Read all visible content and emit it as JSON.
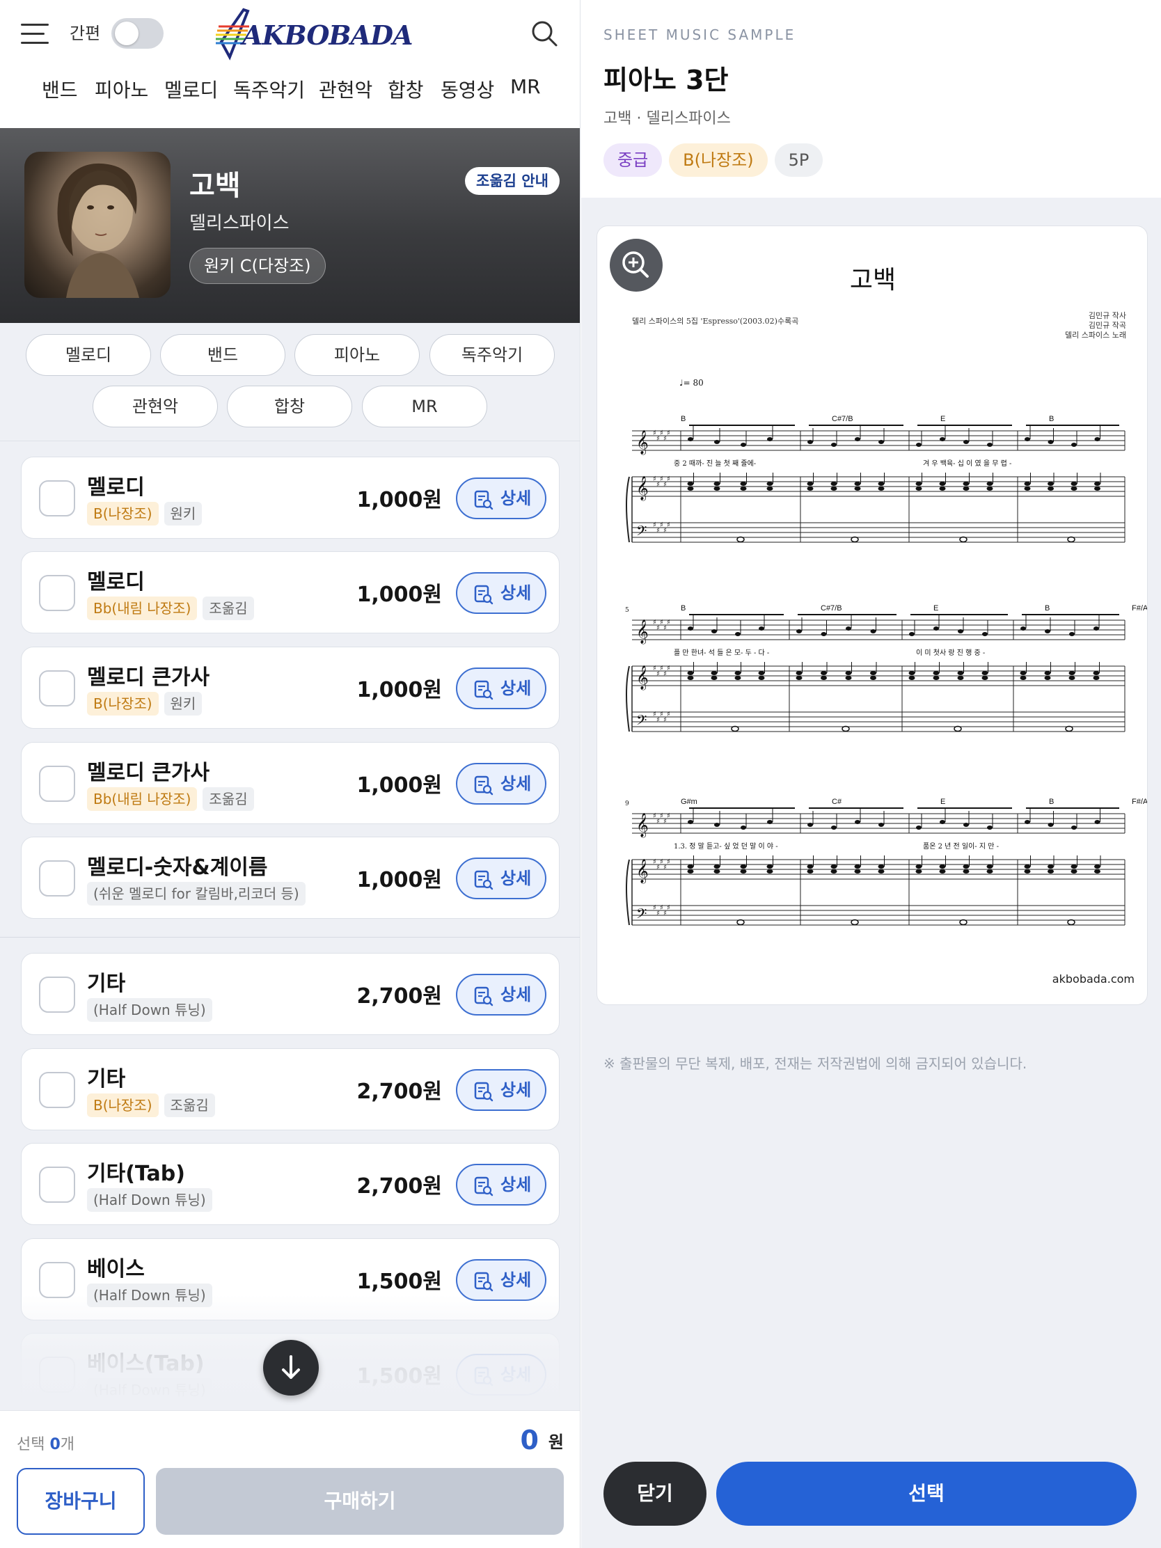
{
  "header": {
    "simple_label": "간편",
    "logo_text": "AKBOBADA",
    "nav": [
      "밴드",
      "피아노",
      "멜로디",
      "독주악기",
      "관현악",
      "합창",
      "동영상",
      "MR"
    ]
  },
  "song": {
    "title": "고백",
    "artist": "델리스파이스",
    "original_key": "원키 C(다장조)",
    "transpose_label": "조옮김 안내"
  },
  "categories": [
    "멜로디",
    "밴드",
    "피아노",
    "독주악기",
    "관현악",
    "합창",
    "MR"
  ],
  "detail_label": "상세",
  "items": [
    {
      "name": "멜로디",
      "tags": [
        {
          "text": "B(나장조)",
          "kind": "key"
        },
        {
          "text": "원키",
          "kind": "gr"
        }
      ],
      "price": "1,000원"
    },
    {
      "name": "멜로디",
      "tags": [
        {
          "text": "Bb(내림 나장조)",
          "kind": "key"
        },
        {
          "text": "조옮김",
          "kind": "gr"
        }
      ],
      "price": "1,000원"
    },
    {
      "name": "멜로디 큰가사",
      "tags": [
        {
          "text": "B(나장조)",
          "kind": "key"
        },
        {
          "text": "원키",
          "kind": "gr"
        }
      ],
      "price": "1,000원"
    },
    {
      "name": "멜로디 큰가사",
      "tags": [
        {
          "text": "Bb(내림 나장조)",
          "kind": "key"
        },
        {
          "text": "조옮김",
          "kind": "gr"
        }
      ],
      "price": "1,000원"
    },
    {
      "name": "멜로디-숫자&계이름",
      "tags": [
        {
          "text": "(쉬운 멜로디 for 칼림바,리코더 등)",
          "kind": "gr"
        }
      ],
      "price": "1,000원"
    },
    {
      "name": "기타",
      "tags": [
        {
          "text": "(Half Down 튜닝)",
          "kind": "gr"
        }
      ],
      "price": "2,700원"
    },
    {
      "name": "기타",
      "tags": [
        {
          "text": "B(나장조)",
          "kind": "key"
        },
        {
          "text": "조옮김",
          "kind": "gr"
        }
      ],
      "price": "2,700원"
    },
    {
      "name": "기타(Tab)",
      "tags": [
        {
          "text": "(Half Down 튜닝)",
          "kind": "gr"
        }
      ],
      "price": "2,700원"
    },
    {
      "name": "베이스",
      "tags": [
        {
          "text": "(Half Down 튜닝)",
          "kind": "gr"
        }
      ],
      "price": "1,500원"
    },
    {
      "name": "베이스(Tab)",
      "tags": [
        {
          "text": "(Half Down 튜닝)",
          "kind": "gr"
        }
      ],
      "price": "1,500원"
    }
  ],
  "bottom": {
    "selected_prefix": "선택 ",
    "selected_count": "0",
    "selected_suffix": "개",
    "total": "0",
    "currency": "원",
    "cart_label": "장바구니",
    "buy_label": "구매하기"
  },
  "preview": {
    "eyebrow": "SHEET MUSIC SAMPLE",
    "title": "피아노 3단",
    "subtitle": "고백 · 델리스파이스",
    "badges": [
      {
        "text": "중급",
        "kind": "lv"
      },
      {
        "text": "B(나장조)",
        "kind": "ky"
      },
      {
        "text": "5P",
        "kind": "pg"
      }
    ],
    "sheet": {
      "title": "고백",
      "note": "델리 스파이스의 5집 'Espresso'(2003.02)수록곡",
      "credits": [
        "김민규 작사",
        "김민규 작곡",
        "델리 스파이스 노래"
      ],
      "tempo": "♩= 80",
      "site": "akbobada.com",
      "systems": [
        {
          "start": "",
          "chords": [
            "B",
            "C#7/B",
            "E",
            "B"
          ],
          "lyrics": [
            "중 2 때까- 진 늘 첫   째 줄에-",
            "겨 우 백육- 십 이 였   을 무   렵 -"
          ]
        },
        {
          "start": "5",
          "chords": [
            "B",
            "C#7/B",
            "E",
            "B",
            "F#/A#"
          ],
          "lyrics": [
            "플 만 한녀- 석 들 은   모- 두 - 다 -",
            "이  미 첫사 랑 진   행 중 -"
          ]
        },
        {
          "start": "9",
          "chords": [
            "G#m",
            "C#",
            "E",
            "B",
            "F#/A#"
          ],
          "lyrics": [
            "1.3. 정 말 듣고-  싶 었 던   말 이   야 -",
            "품온  2 년 전 일이-   지 만 -"
          ]
        }
      ]
    },
    "copyright": "※ 출판물의 무단 복제, 배포, 전재는 저작권법에 의해 금지되어 있습니다.",
    "close_label": "닫기",
    "select_label": "선택"
  }
}
